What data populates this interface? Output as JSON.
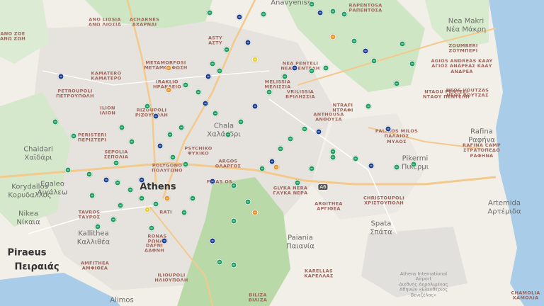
{
  "map": {
    "colors": {
      "sea": "#a9cde8",
      "land": "#f2efe9",
      "urban": "#e6e3de",
      "forest": "#cfe6c4",
      "forest_dark": "#b9d9a9",
      "road_major": "#f3c98c",
      "road_minor": "#ffffff"
    },
    "marker_colors": {
      "green": "#1e9e5e",
      "blue": "#1d3f8f",
      "orange": "#e8962d",
      "yellow": "#e7cf3a"
    },
    "labels": [
      {
        "text": "ANO LIOSIA\nΑΝΩ ΛΙΟΣΙΑ",
        "kind": "suburb"
      },
      {
        "text": "ACHARNES\nΑΧΑΡΝΑΙ",
        "kind": "suburb"
      },
      {
        "text": "ANO ZOE\nΑΝΩ ΖΩΗ",
        "kind": "suburb"
      },
      {
        "text": "Anavyenissi",
        "kind": "city"
      },
      {
        "text": "RAPENTOSA\nΡΑΠΕΝΤΟΣΑ",
        "kind": "suburb"
      },
      {
        "text": "Nea Makri\nΝέα Μάκρη",
        "kind": "city"
      },
      {
        "text": "ZOUMBERI\nΖΟΥΜΠΕΡΙ",
        "kind": "suburb"
      },
      {
        "text": "AGIOS ANDREAS KAAY\nΑΓΙΟΣ ΑΝΔΡΕΑΣ ΚΑΑΥ\nΑΝΔΡΕΑ",
        "kind": "suburb"
      },
      {
        "text": "KAMATERO\nΚΑΜΑΤΕΡΟ",
        "kind": "suburb"
      },
      {
        "text": "METAMORFOSI\nΜΕΤΑΜΟΡΦΩΣΗ",
        "kind": "suburb"
      },
      {
        "text": "ASTY\nΑΣΤΥ",
        "kind": "suburb"
      },
      {
        "text": "NEA PENTELI\nΝΕΑ ΠΕΝΤΕΛΗ",
        "kind": "suburb"
      },
      {
        "text": "PETROUPOLI\nΠΕΤΡΟΥΠΟΛΗ",
        "kind": "suburb"
      },
      {
        "text": "ILION\nΙΛΙΟΝ",
        "kind": "suburb"
      },
      {
        "text": "IRAKLIO\nΗΡΑΚΛΕΙΟ",
        "kind": "suburb"
      },
      {
        "text": "RIZOUPOLI\nΡΙΖΟΥΠΟΛΗ",
        "kind": "suburb"
      },
      {
        "text": "MELISSIA\nΜΕΛΙΣΣΙΑ",
        "kind": "suburb"
      },
      {
        "text": "VRILISSIA\nΒΡΙΛΗΣΣΙΑ",
        "kind": "suburb"
      },
      {
        "text": "NTAOU PENTELI\nΝΤΑΟΥ ΠΕΝΤΕΛΗ",
        "kind": "suburb"
      },
      {
        "text": "NEOS VOUTZAS\nΝΕΟΣ ΒΟΥΤΖΑΣ",
        "kind": "suburb"
      },
      {
        "text": "NTRAFI\nΝΤΡΑΦΙ",
        "kind": "suburb"
      },
      {
        "text": "ANTHOUSA\nΑΝΘΟΥΣΑ",
        "kind": "suburb"
      },
      {
        "text": "Chala\nΧαλάνδρι",
        "kind": "city"
      },
      {
        "text": "Rafina\nΡαφήνα",
        "kind": "city"
      },
      {
        "text": "PALAIOS MILOS\nΠΑΛΑΙΟΣ\nΜΥΛΟΣ",
        "kind": "suburb"
      },
      {
        "text": "RAFINA CAMP\nΣΤΡΑΤΟΠΕΔΟ\nΡΑΦΗΝΑ",
        "kind": "suburb"
      },
      {
        "text": "Chaidari\nΧαϊδάρι",
        "kind": "city"
      },
      {
        "text": "PERISTERI\nΠΕΡΙΣΤΕΡΙ",
        "kind": "suburb"
      },
      {
        "text": "SEPOLIA\nΣΕΠΟΛΙΑ",
        "kind": "suburb"
      },
      {
        "text": "PSYCHIKO\nΨΥΧΙΚΟ",
        "kind": "suburb"
      },
      {
        "text": "POLYGONO\nΠΟΛΥΓΩΝΟ",
        "kind": "suburb"
      },
      {
        "text": "ARGOS\nΟΛΑΡΓΟΣ",
        "kind": "suburb"
      },
      {
        "text": "Pikermi\nΠικέρμι",
        "kind": "city"
      },
      {
        "text": "Korydallos\nΚορυδαλλός",
        "kind": "city"
      },
      {
        "text": "Egaleo\nΑιγάλεω",
        "kind": "city"
      },
      {
        "text": "Athens",
        "kind": "major"
      },
      {
        "text": "PAIAS OS",
        "kind": "suburb"
      },
      {
        "text": "GLYKA NERA\nΓΛΥΚΑ ΝΕΡΑ",
        "kind": "suburb"
      },
      {
        "text": "CHRISTOUPOLI\nΧΡΙΣΤΟΥΠΟΛΗ",
        "kind": "suburb"
      },
      {
        "text": "Artemida\nΑρτέμιδα",
        "kind": "city"
      },
      {
        "text": "Nikea\nΝίκαια",
        "kind": "city"
      },
      {
        "text": "TAVROS\nΤΑΥΡΟΣ",
        "kind": "suburb"
      },
      {
        "text": "RATI",
        "kind": "suburb"
      },
      {
        "text": "ARGITHEA\nΑΡΓΙΘΕΑ",
        "kind": "suburb"
      },
      {
        "text": "Spata\nΣπάτα",
        "kind": "city"
      },
      {
        "text": "Kallithea\nΚαλλιθέα",
        "kind": "city"
      },
      {
        "text": "RONAS\nΡΩΝΑΣ",
        "kind": "suburb"
      },
      {
        "text": "DAFNI\nΔΑΦΝΗ",
        "kind": "suburb"
      },
      {
        "text": "Paiania\nΠαιανία",
        "kind": "city"
      },
      {
        "text": "Piraeus",
        "kind": "major"
      },
      {
        "text": "Πειραιάς",
        "kind": "major"
      },
      {
        "text": "AMFITHEA\nΑΜΦΙΘΕΑ",
        "kind": "suburb"
      },
      {
        "text": "ILIOUPOLI\nΗΛΙΟΥΠΟΛΗ",
        "kind": "suburb"
      },
      {
        "text": "KARELLAS\nΚΑΡΕΛΛΑΣ",
        "kind": "suburb"
      },
      {
        "text": "Athens International\nAirport\nΔιεθνής Αερολιμένας\nΑθηνών «Ελευθέριος\nΒενιζέλος»",
        "kind": "airport"
      },
      {
        "text": "Alimos",
        "kind": "city"
      },
      {
        "text": "BILIZA\nΒΙΛΙΖΑ",
        "kind": "suburb"
      },
      {
        "text": "CHAMOLIA\nΧΑΜΟΛΙΑ",
        "kind": "suburb"
      }
    ],
    "road_shield": "A6",
    "markers": [
      {
        "c": "green"
      },
      {
        "c": "blue"
      },
      {
        "c": "green"
      },
      {
        "c": "green"
      },
      {
        "c": "blue"
      },
      {
        "c": "green"
      },
      {
        "c": "green"
      },
      {
        "c": "orange"
      },
      {
        "c": "green"
      },
      {
        "c": "blue"
      },
      {
        "c": "green"
      },
      {
        "c": "yellow"
      },
      {
        "c": "blue"
      },
      {
        "c": "green"
      },
      {
        "c": "green"
      },
      {
        "c": "blue"
      },
      {
        "c": "green"
      },
      {
        "c": "orange"
      },
      {
        "c": "green"
      },
      {
        "c": "green"
      },
      {
        "c": "blue"
      },
      {
        "c": "green"
      },
      {
        "c": "green"
      },
      {
        "c": "green"
      },
      {
        "c": "blue"
      },
      {
        "c": "green"
      },
      {
        "c": "green"
      },
      {
        "c": "orange"
      },
      {
        "c": "green"
      },
      {
        "c": "blue"
      },
      {
        "c": "green"
      },
      {
        "c": "green"
      },
      {
        "c": "green"
      },
      {
        "c": "blue"
      },
      {
        "c": "green"
      },
      {
        "c": "green"
      },
      {
        "c": "green"
      },
      {
        "c": "yellow"
      },
      {
        "c": "green"
      },
      {
        "c": "blue"
      },
      {
        "c": "green"
      },
      {
        "c": "green"
      },
      {
        "c": "blue"
      },
      {
        "c": "green"
      },
      {
        "c": "green"
      },
      {
        "c": "orange"
      },
      {
        "c": "green"
      },
      {
        "c": "blue"
      },
      {
        "c": "green"
      },
      {
        "c": "green"
      },
      {
        "c": "green"
      },
      {
        "c": "blue"
      },
      {
        "c": "green"
      },
      {
        "c": "green"
      },
      {
        "c": "green"
      },
      {
        "c": "blue"
      },
      {
        "c": "green"
      },
      {
        "c": "orange"
      },
      {
        "c": "green"
      },
      {
        "c": "green"
      },
      {
        "c": "green"
      },
      {
        "c": "green"
      },
      {
        "c": "blue"
      },
      {
        "c": "green"
      },
      {
        "c": "green"
      },
      {
        "c": "green"
      },
      {
        "c": "blue"
      },
      {
        "c": "green"
      },
      {
        "c": "green"
      },
      {
        "c": "green"
      },
      {
        "c": "green"
      },
      {
        "c": "blue"
      },
      {
        "c": "green"
      },
      {
        "c": "green"
      },
      {
        "c": "green"
      },
      {
        "c": "blue"
      },
      {
        "c": "green"
      },
      {
        "c": "green"
      },
      {
        "c": "orange"
      },
      {
        "c": "green"
      },
      {
        "c": "green"
      },
      {
        "c": "blue"
      },
      {
        "c": "green"
      },
      {
        "c": "green"
      },
      {
        "c": "green"
      },
      {
        "c": "green"
      },
      {
        "c": "blue"
      },
      {
        "c": "green"
      },
      {
        "c": "green"
      },
      {
        "c": "green"
      }
    ]
  }
}
